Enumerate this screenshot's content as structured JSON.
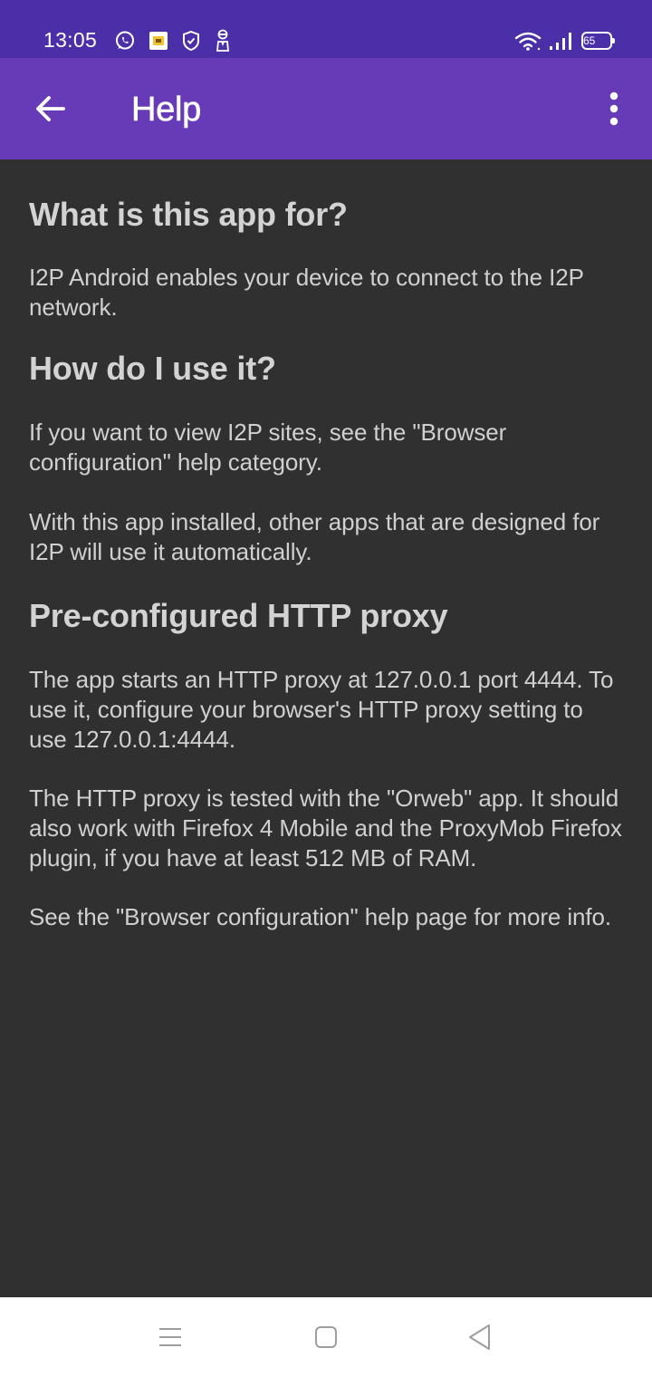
{
  "status_bar": {
    "time": "13:05",
    "battery_level": "65",
    "left_icons": [
      "whatsapp-icon",
      "notification-app-icon",
      "vpn-shield-icon",
      "spy-icon"
    ],
    "right_icons": [
      "wifi-icon",
      "cellular-signal-icon",
      "battery-icon"
    ]
  },
  "app_bar": {
    "title": "Help",
    "back_icon": "arrow-left-icon",
    "overflow_icon": "more-vert-icon",
    "color": "#673ab7"
  },
  "content": {
    "sections": [
      {
        "heading": "What is this app for?",
        "paragraphs": [
          "I2P Android enables your device to connect to the I2P network."
        ]
      },
      {
        "heading": "How do I use it?",
        "paragraphs": [
          "If you want to view I2P sites, see the \"Browser configuration\" help category.",
          "With this app installed, other apps that are designed for I2P will use it automatically."
        ]
      },
      {
        "heading": "Pre-configured HTTP proxy",
        "paragraphs": [
          "The app starts an HTTP proxy at 127.0.0.1 port 4444. To use it, configure your browser's HTTP proxy setting to use 127.0.0.1:4444.",
          "The HTTP proxy is tested with the \"Orweb\" app. It should also work with Firefox 4 Mobile and the ProxyMob Firefox plugin, if you have at least 512 MB of RAM.",
          "See the \"Browser configuration\" help page for more info."
        ]
      }
    ]
  },
  "nav_bar": {
    "buttons": [
      "recent-apps-icon",
      "home-icon",
      "back-triangle-icon"
    ]
  }
}
